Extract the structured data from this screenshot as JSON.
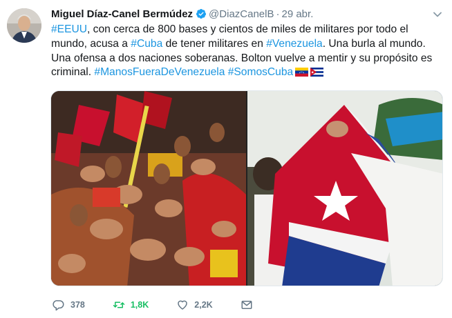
{
  "author": {
    "name": "Miguel Díaz-Canel Bermúdez",
    "handle": "@DiazCanelB",
    "separator": "·",
    "date": "29 abr."
  },
  "tweet": {
    "segments": [
      {
        "text": "#EEUU",
        "hashtag": true
      },
      {
        "text": ", con cerca de 800 bases y cientos de miles de militares por todo el mundo, acusa  a ",
        "hashtag": false
      },
      {
        "text": "#Cuba",
        "hashtag": true
      },
      {
        "text": " de tener militares en ",
        "hashtag": false
      },
      {
        "text": "#Venezuela",
        "hashtag": true
      },
      {
        "text": ". Una burla al mundo. Una ofensa a dos naciones soberanas. Bolton vuelve a mentir y su propósito es criminal. ",
        "hashtag": false
      },
      {
        "text": "#ManosFueraDeVenezuela",
        "hashtag": true
      },
      {
        "text": " ",
        "hashtag": false
      },
      {
        "text": "#SomosCuba",
        "hashtag": true
      }
    ],
    "emojis": [
      "venezuela-flag-icon",
      "cuba-flag-icon"
    ]
  },
  "actions": {
    "replies": "378",
    "retweets": "1,8K",
    "likes": "2,2K"
  },
  "colors": {
    "link": "#1b95e0",
    "retweet_active": "#17bf63",
    "muted": "#657786",
    "verified": "#1da1f2"
  }
}
